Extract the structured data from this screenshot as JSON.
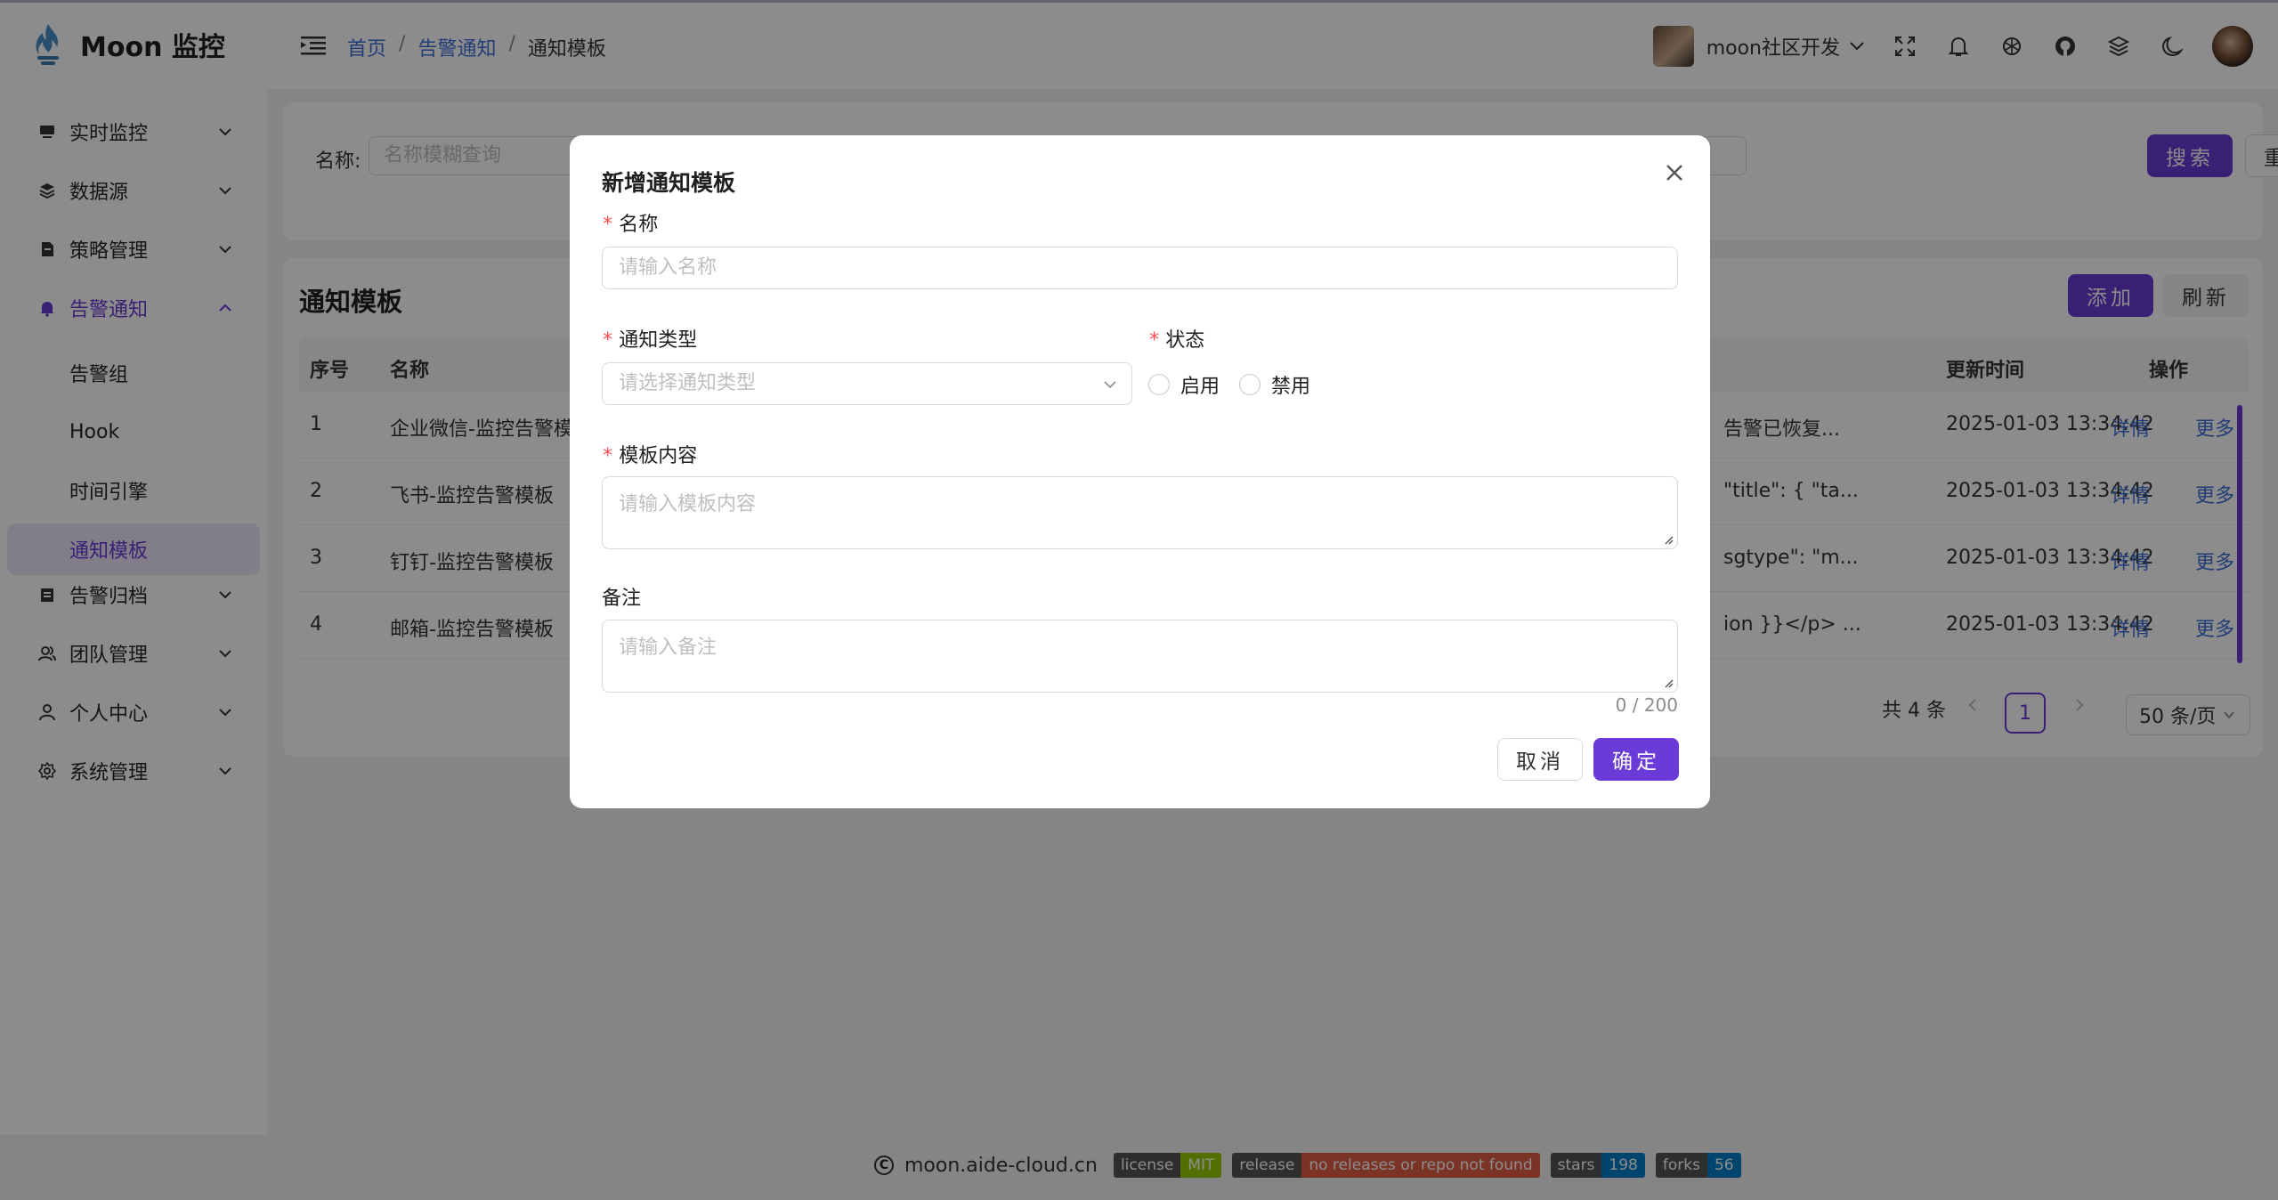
{
  "app": {
    "brand": "Moon 监控",
    "colors": {
      "accent": "#6a3bd6",
      "link": "#3f6fd8",
      "required": "#ff4d4f"
    }
  },
  "breadcrumb": [
    "首页",
    "告警通知",
    "通知模板"
  ],
  "header": {
    "user_name": "moon社区开发",
    "icons": [
      "fullscreen-icon",
      "bell-icon",
      "openai-icon",
      "github-icon",
      "layers-icon",
      "moon-icon"
    ]
  },
  "sidebar": {
    "items": [
      {
        "label": "实时监控",
        "icon": "monitor-icon"
      },
      {
        "label": "数据源",
        "icon": "database-icon"
      },
      {
        "label": "策略管理",
        "icon": "policy-icon"
      },
      {
        "label": "告警通知",
        "icon": "bell-icon",
        "expanded": true
      },
      {
        "label": "告警归档",
        "icon": "archive-icon"
      },
      {
        "label": "团队管理",
        "icon": "team-icon"
      },
      {
        "label": "个人中心",
        "icon": "user-icon"
      },
      {
        "label": "系统管理",
        "icon": "settings-icon"
      }
    ],
    "subitems": [
      "告警组",
      "Hook",
      "时间引擎",
      "通知模板"
    ],
    "selected_subitem": "通知模板"
  },
  "search": {
    "name_label": "名称:",
    "name_placeholder": "名称模糊查询",
    "search_button": "搜索",
    "reset_button": "重置"
  },
  "table": {
    "title": "通知模板",
    "add_button": "添加",
    "refresh_button": "刷新",
    "columns": {
      "index": "序号",
      "name": "名称",
      "updated": "更新时间",
      "actions": "操作"
    },
    "rows": [
      {
        "index": "1",
        "name": "企业微信-监控告警模板",
        "content": "告警已恢复...",
        "updated": "2025-01-03 13:34:42",
        "detail": "详情",
        "more": "更多"
      },
      {
        "index": "2",
        "name": "飞书-监控告警模板",
        "content": "\"title\": { \"ta...",
        "updated": "2025-01-03 13:34:42",
        "detail": "详情",
        "more": "更多"
      },
      {
        "index": "3",
        "name": "钉钉-监控告警模板",
        "content": "sgtype\": \"m...",
        "updated": "2025-01-03 13:34:42",
        "detail": "详情",
        "more": "更多"
      },
      {
        "index": "4",
        "name": "邮箱-监控告警模板",
        "content": "ion }}</p> ...",
        "updated": "2025-01-03 13:34:42",
        "detail": "详情",
        "more": "更多"
      }
    ],
    "pagination": {
      "total_text": "共 4 条",
      "current_page": "1",
      "page_size": "50 条/页"
    }
  },
  "modal": {
    "title": "新增通知模板",
    "name_label": "名称",
    "name_placeholder": "请输入名称",
    "type_label": "通知类型",
    "type_placeholder": "请选择通知类型",
    "status_label": "状态",
    "status_options": [
      "启用",
      "禁用"
    ],
    "content_label": "模板内容",
    "content_placeholder": "请输入模板内容",
    "remark_label": "备注",
    "remark_placeholder": "请输入备注",
    "remark_counter": "0 / 200",
    "cancel_button": "取消",
    "ok_button": "确定"
  },
  "footer": {
    "site": "moon.aide-cloud.cn",
    "badges": [
      {
        "label": "license",
        "value": "MIT",
        "color": "#97ca00"
      },
      {
        "label": "release",
        "value": "no releases or repo not found",
        "color": "#e05d44"
      },
      {
        "label": "stars",
        "value": "198",
        "color": "#007ec6"
      },
      {
        "label": "forks",
        "value": "56",
        "color": "#007ec6"
      }
    ]
  }
}
